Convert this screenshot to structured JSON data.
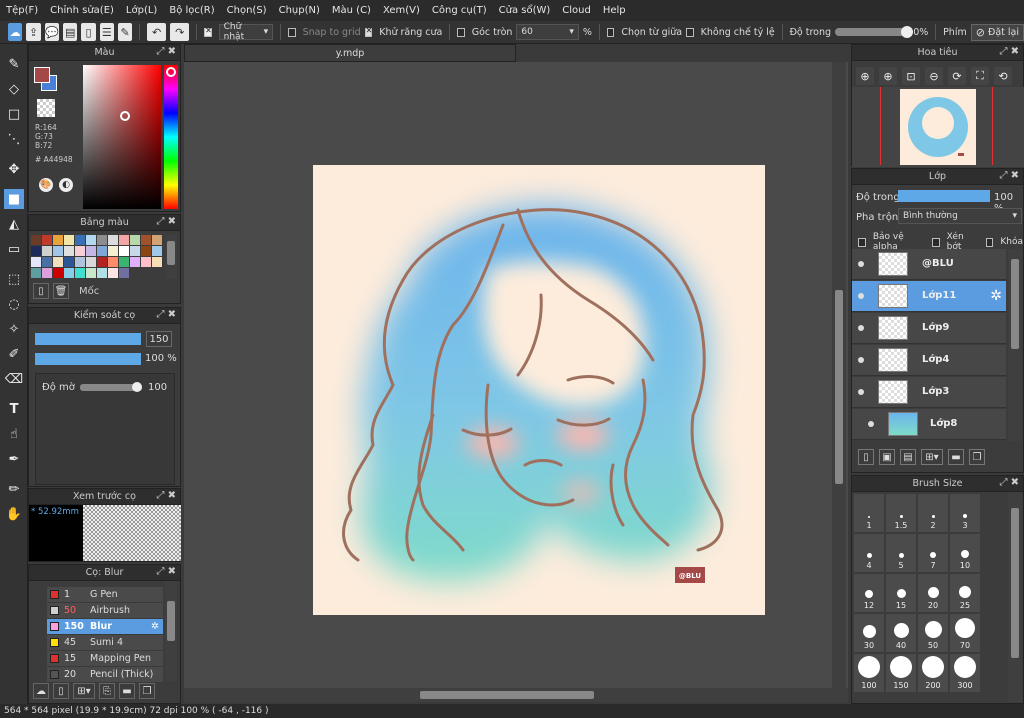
{
  "menu": [
    "Tệp(F)",
    "Chỉnh sửa(E)",
    "Lớp(L)",
    "Bộ lọc(R)",
    "Chọn(S)",
    "Chụp(N)",
    "Màu (C)",
    "Xem(V)",
    "Công cụ(T)",
    "Cửa sổ(W)",
    "Cloud",
    "Help"
  ],
  "toolbar": {
    "shape": "Chữ nhật",
    "snap": "Snap to grid",
    "antialias": "Khử răng cưa",
    "round_corner": "Góc tròn",
    "round_value": "60",
    "percent": "%",
    "from_center": "Chọn từ giữa",
    "fixed_ratio": "Không chế tỷ lệ",
    "opacity_label": "Độ trong",
    "opacity_value": "100%",
    "opacity_fraction": 1.0,
    "key_label": "Phím",
    "reset_label": "Đặt lại"
  },
  "color_panel": {
    "title": "Màu",
    "r": "R:164",
    "g": "G:73",
    "b": "B:72",
    "hex": "# A44948",
    "fg": "#a44948",
    "bg": "#4a7fd8"
  },
  "palette": {
    "title": "Bảng màu",
    "moc": "Mốc",
    "colors": [
      "#6b3b2a",
      "#c0392b",
      "#e8a33b",
      "#f2e6a8",
      "#3a6fb3",
      "#b4d7f0",
      "#8d8d8d",
      "#dcdcdc",
      "#f4a6a6",
      "#b7d8a8",
      "#a0522d",
      "#d4a373",
      "#1e2a5a",
      "#d0d0d0",
      "#9fc5e8",
      "#e0e0e0",
      "#f8cfd6",
      "#c4b7e6",
      "#7fa7d9",
      "#f5f0d0",
      "#ffffff",
      "#c7d8e8",
      "#8b4513",
      "#a0c8e8",
      "#e6e6fa",
      "#4a6fa5",
      "#f0e0c0",
      "#2b5797",
      "#b0c4de",
      "#d9d9d9",
      "#b22222",
      "#ff8c69",
      "#3cb371",
      "#e0b0ff",
      "#ffc0cb",
      "#f5deb3",
      "#5f9ea0",
      "#dda0dd",
      "#cc0000",
      "#87ceeb",
      "#40e0d0",
      "#c8e6c9",
      "#b0e0e6",
      "#ffe4e1",
      "#7070a0"
    ]
  },
  "brush_control": {
    "title": "Kiểm soát cọ",
    "size": "150",
    "size_fraction": 1.0,
    "opacity": "100 %",
    "opacity_fraction": 1.0,
    "blur_label": "Độ mờ",
    "blur_value": "100",
    "blur_fraction": 1.0
  },
  "preview": {
    "title": "Xem trước cọ",
    "size": "* 52.92mm"
  },
  "brush_list": {
    "title": "Cọ: Blur",
    "items": [
      {
        "size": "1",
        "name": "G Pen",
        "color": "#e03030",
        "selected": false
      },
      {
        "size": "50",
        "name": "Airbrush",
        "color": "#cfcfcf",
        "selected": false
      },
      {
        "size": "150",
        "name": "Blur",
        "color": "#ff9ee0",
        "selected": true
      },
      {
        "size": "45",
        "name": "Sumi 4",
        "color": "#ffe000",
        "selected": false
      },
      {
        "size": "15",
        "name": "Mapping Pen",
        "color": "#e03030",
        "selected": false
      },
      {
        "size": "20",
        "name": "Pencil (Thick)",
        "color": "#555555",
        "selected": false
      }
    ]
  },
  "document": {
    "tab": "y.mdp",
    "signature": "@BLU"
  },
  "navigator": {
    "title": "Hoa tiêu"
  },
  "layers": {
    "title": "Lớp",
    "opacity_label": "Độ trong",
    "opacity_value": "100 %",
    "opacity_fraction": 1.0,
    "blend_label": "Pha trộn",
    "blend_value": "Bình thường",
    "protect_alpha": "Bảo vệ alpha",
    "clip": "Xén bớt",
    "lock": "Khóa",
    "items": [
      {
        "name": "@BLU",
        "selected": false
      },
      {
        "name": "Lớp11",
        "selected": true
      },
      {
        "name": "Lớp9",
        "selected": false
      },
      {
        "name": "Lớp4",
        "selected": false
      },
      {
        "name": "Lớp3",
        "selected": false
      },
      {
        "name": "Lớp8",
        "selected": false
      }
    ]
  },
  "brush_size": {
    "title": "Brush Size",
    "sizes": [
      "1",
      "1.5",
      "2",
      "3",
      "4",
      "5",
      "7",
      "10",
      "12",
      "15",
      "20",
      "25",
      "30",
      "40",
      "50",
      "70",
      "100",
      "150",
      "200",
      "300"
    ]
  },
  "status": "564 * 564 pixel   (19.9 * 19.9cm)   72 dpi   100 %   ( -64 , -116 )"
}
